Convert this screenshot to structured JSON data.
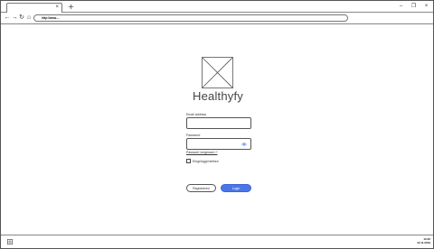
{
  "browser": {
    "tab": {
      "close_label": "×"
    },
    "new_tab_icon": "plus-icon",
    "window_controls": {
      "minimize": "–",
      "maximize": "❐",
      "close": "×"
    },
    "nav": {
      "back": "←",
      "forward": "→",
      "reload": "↻",
      "home": "⌂"
    },
    "url": "http://www...."
  },
  "login": {
    "logo_icon": "image-placeholder-icon",
    "app_name": "Healthyfy",
    "email_label": "Email address",
    "email_value": "",
    "password_label": "Password",
    "password_value": "",
    "password_toggle_icon": "eye-icon",
    "forgot_link": "Passwort vergessen ?",
    "remember_label": "Eingeloggt bleiben",
    "register_button": "Registrieren",
    "login_button": "Login"
  },
  "taskbar": {
    "start_icon": "windows-icon",
    "time": "10:20",
    "date": "12.11.2019"
  },
  "colors": {
    "accent": "#4a76e8",
    "border": "#555555",
    "background": "#ffffff"
  }
}
